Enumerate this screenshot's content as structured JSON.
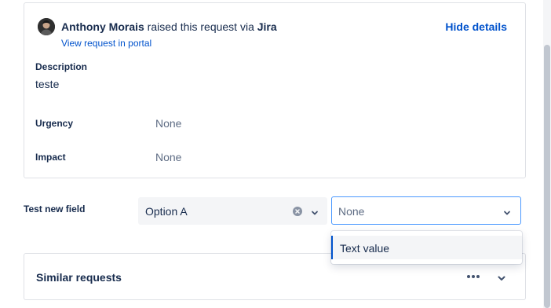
{
  "request": {
    "reporter": "Anthony Morais",
    "raised_text": " raised this request via ",
    "channel": "Jira",
    "portal_link": "View request in portal",
    "hide_details": "Hide details"
  },
  "fields": {
    "description_label": "Description",
    "description_value": "teste",
    "urgency_label": "Urgency",
    "urgency_value": "None",
    "impact_label": "Impact",
    "impact_value": "None"
  },
  "test_field": {
    "label": "Test new field",
    "select_a_value": "Option A",
    "select_b_value": "None",
    "dropdown_options": [
      "Text value"
    ]
  },
  "similar": {
    "title": "Similar requests"
  },
  "icons": {
    "avatar": "user-avatar",
    "clear": "clear-icon",
    "chevron": "chevron-down-icon",
    "more": "more-horizontal-icon"
  },
  "colors": {
    "link": "#0052cc",
    "text": "#172b4d",
    "subtle": "#5e6c84",
    "focus_border": "#4c9aff",
    "field_bg": "#f4f5f7"
  }
}
